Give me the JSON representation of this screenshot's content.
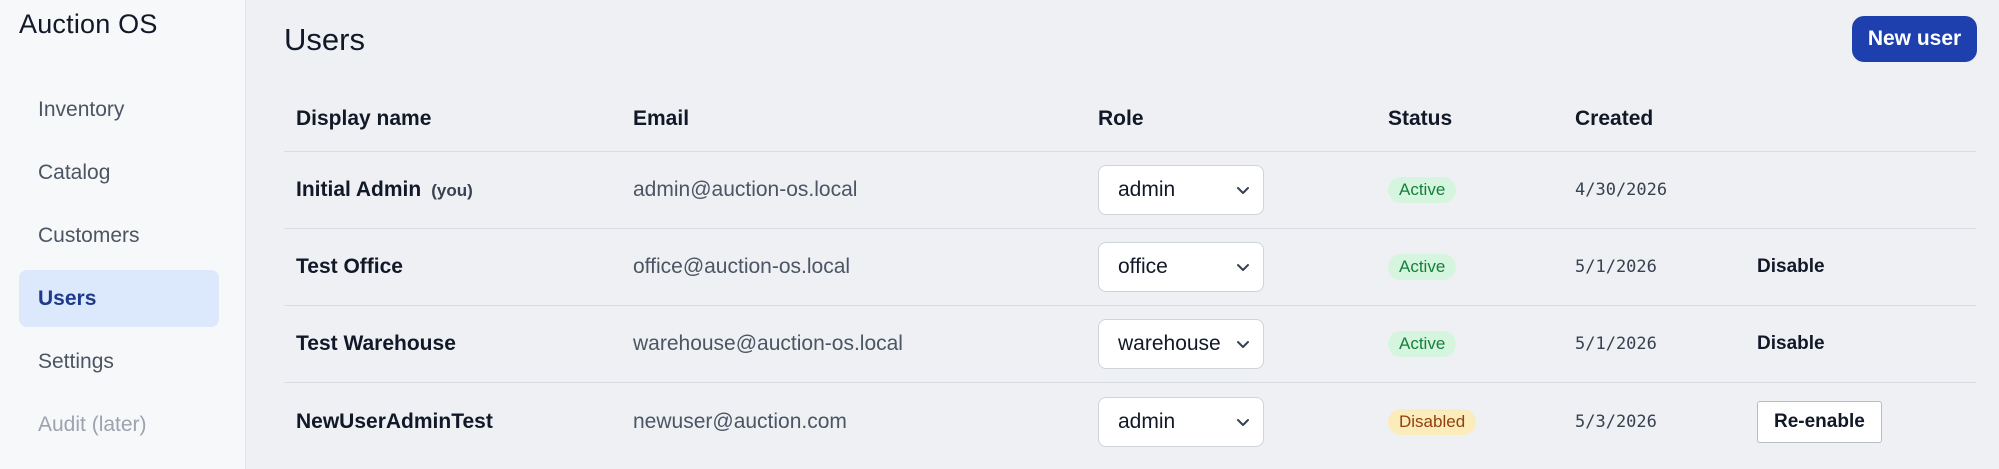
{
  "sidebar": {
    "brand": "Auction OS",
    "items": [
      {
        "label": "Inventory"
      },
      {
        "label": "Catalog"
      },
      {
        "label": "Customers"
      },
      {
        "label": "Users"
      },
      {
        "label": "Settings"
      },
      {
        "label": "Audit (later)"
      }
    ]
  },
  "header": {
    "title": "Users",
    "new_user_label": "New user"
  },
  "table": {
    "columns": [
      "Display name",
      "Email",
      "Role",
      "Status",
      "Created"
    ],
    "rows": [
      {
        "name": "Initial Admin",
        "you": "(you)",
        "email": "admin@auction-os.local",
        "role": "admin",
        "status": "Active",
        "created": "4/30/2026",
        "action": ""
      },
      {
        "name": "Test Office",
        "you": "",
        "email": "office@auction-os.local",
        "role": "office",
        "status": "Active",
        "created": "5/1/2026",
        "action": "Disable"
      },
      {
        "name": "Test Warehouse",
        "you": "",
        "email": "warehouse@auction-os.local",
        "role": "warehouse",
        "status": "Active",
        "created": "5/1/2026",
        "action": "Disable"
      },
      {
        "name": "NewUserAdminTest",
        "you": "",
        "email": "newuser@auction.com",
        "role": "admin",
        "status": "Disabled",
        "created": "5/3/2026",
        "action": "Re-enable"
      }
    ]
  },
  "colors": {
    "accent": "#1e40af",
    "active_nav_bg": "#dce8fb",
    "status_active_bg": "#d6f5de",
    "status_disabled_bg": "#fbecbb"
  }
}
